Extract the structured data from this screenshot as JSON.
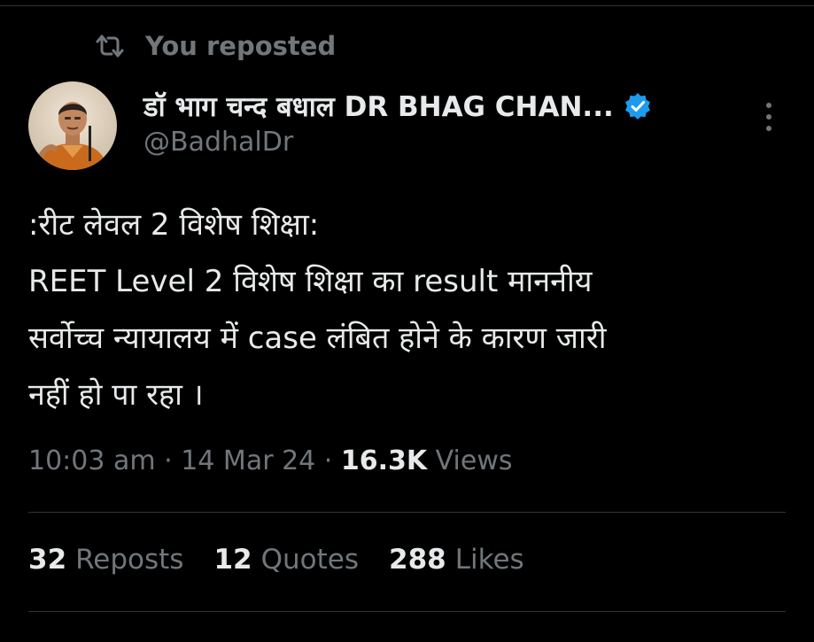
{
  "repost_banner": {
    "text": "You reposted",
    "icon": "repost-icon"
  },
  "author": {
    "display_name": "डॉ भाग चन्द बधाल DR BHAG CHAN...",
    "handle": "@BadhalDr",
    "verified": true,
    "verified_color": "#1d9bf0"
  },
  "tweet": {
    "lines": [
      ":रीट लेवल 2 विशेष शिक्षा:",
      "REET Level 2 विशेष शिक्षा का result माननीय",
      "सर्वोच्च न्यायालय में case लंबित होने के कारण जारी",
      "नहीं हो पा रहा ।"
    ]
  },
  "meta": {
    "time": "10:03 am",
    "separator": " · ",
    "date": "14 Mar 24",
    "views_count": "16.3K",
    "views_label": "Views"
  },
  "stats": {
    "reposts_count": "32",
    "reposts_label": "Reposts",
    "quotes_count": "12",
    "quotes_label": "Quotes",
    "likes_count": "288",
    "likes_label": "Likes"
  },
  "colors": {
    "background": "#000000",
    "primary_text": "#e7e9ea",
    "secondary_text": "#71767b",
    "divider": "#2f3336"
  }
}
